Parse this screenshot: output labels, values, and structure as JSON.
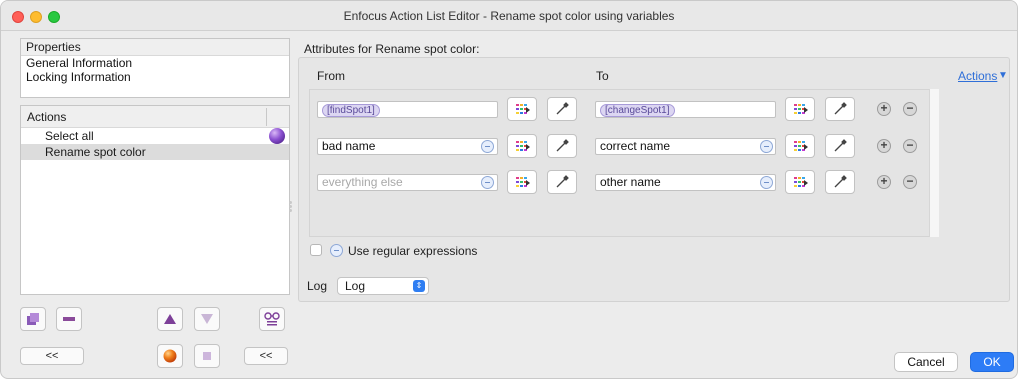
{
  "window": {
    "title": "Enfocus Action List Editor - Rename spot color using variables"
  },
  "properties": {
    "header": "Properties",
    "items": [
      "General Information",
      "Locking Information"
    ]
  },
  "actions_panel": {
    "header": "Actions",
    "items": [
      {
        "label": "Select all"
      },
      {
        "label": "Rename spot color"
      }
    ]
  },
  "left_buttons": {
    "back_label_1": "<<",
    "back_label_2": "<<"
  },
  "attributes": {
    "title": "Attributes for Rename spot color:",
    "from_label": "From",
    "to_label": "To",
    "actions_menu": "Actions",
    "rows": [
      {
        "from": "[findSpot1]",
        "to": "[changeSpot1]"
      },
      {
        "from": "bad name",
        "to": "correct name"
      },
      {
        "from": "everything else",
        "to": "other name"
      }
    ]
  },
  "regex": {
    "label": "Use regular expressions"
  },
  "log": {
    "label": "Log",
    "value": "Log"
  },
  "footer": {
    "cancel": "Cancel",
    "ok": "OK"
  },
  "colors": {
    "accent": "#2d7cf6",
    "link": "#2f6fd8",
    "tag": "#dcd6f2"
  }
}
